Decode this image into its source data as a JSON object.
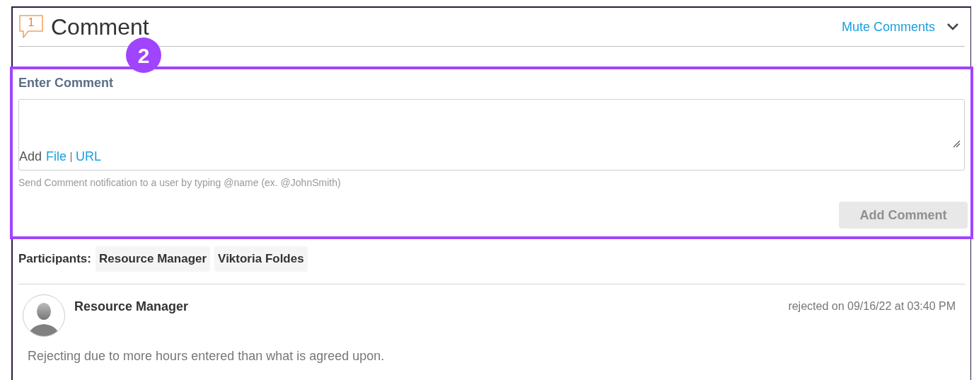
{
  "header": {
    "count": "1",
    "title": "Comment",
    "mute_link": "Mute Comments"
  },
  "step_badge": "2",
  "composer": {
    "label": "Enter Comment",
    "add_label": "Add",
    "attach_links": [
      "File",
      "URL"
    ],
    "hint": "Send Comment notification to a user by typing @name (ex. @JohnSmith)",
    "submit": {
      "label": "Add Comment",
      "disabled": true
    }
  },
  "participants": {
    "label": "Participants:",
    "names": [
      "Resource Manager",
      "Viktoria Foldes"
    ]
  },
  "comments": [
    {
      "author": "Resource Manager",
      "timestamp": "rejected on 09/16/22 at 03:40 PM",
      "body": "Rejecting due to more hours entered than what is agreed upon."
    }
  ]
}
